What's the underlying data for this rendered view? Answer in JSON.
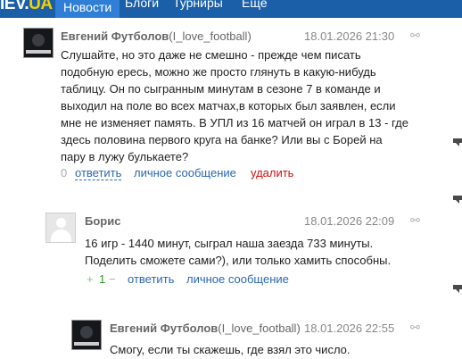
{
  "site": {
    "logo_part1": "IEV.",
    "logo_part2": "UA"
  },
  "nav": {
    "items": [
      "Новости",
      "Блоги",
      "Турниры",
      "Ещё"
    ]
  },
  "comments": [
    {
      "author": "Евгений Футболов",
      "nick": "(I_love_football)",
      "date": "18.01.2026 21:30",
      "lines": [
        "Слушайте, но это даже не смешно - прежде чем писать",
        "подобную ересь, можно же просто глянуть в какую-нибудь",
        "таблицу. Он по сыгранным минутам в сезоне 7 в команде и",
        "выходил на поле во всех матчах,в которых был заявлен, если",
        "мне не изменяет память. В УПЛ из 16 матчей он играл в 13 - где",
        "здесь половина первого круга на банке? Или вы с Борей на",
        "пару в лужу булькаете?"
      ],
      "rating": "0",
      "reply": "ответить",
      "message": "личное сообщение",
      "delete": "удалить"
    },
    {
      "author": "Борис",
      "date": "18.01.2026 22:09",
      "lines": [
        "16 игр - 1440 минут, сыграл наша заезда 733 минуты.",
        "Поделить сможете сами?), или только хамить способны."
      ],
      "plus": "+",
      "rating": "1",
      "minus": "−",
      "reply": "ответить",
      "message": "личное сообщение"
    },
    {
      "author": "Евгений Футболов",
      "nick": "(I_love_football)",
      "date": "18.01.2026 22:55",
      "lines": [
        "Смогу, если ты скажешь, где взял это число."
      ]
    }
  ],
  "icons": {
    "permalink": "link-icon",
    "avatar_default": "user-silhouette-icon",
    "avatar_custom": "team-logo-icon"
  },
  "colors": {
    "nav_bg": "#1a5fa8",
    "link": "#2a67b2",
    "delete": "#cc1111",
    "logo_accent": "#f5d000"
  }
}
